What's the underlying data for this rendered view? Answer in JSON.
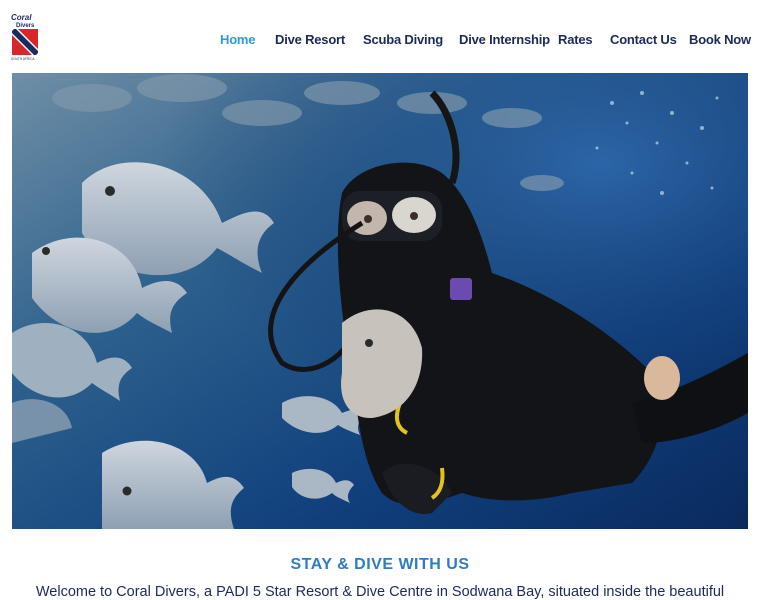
{
  "brand": {
    "logo_line1": "Coral",
    "logo_line2": "Divers",
    "logo_sub": "SOUTH AFRICA",
    "colors": {
      "navy": "#1b2a5c",
      "accent": "#2e9bd6",
      "flag_red": "#d9262b"
    }
  },
  "nav": {
    "items": [
      {
        "label": "Home",
        "active": true
      },
      {
        "label": "Dive Resort",
        "active": false
      },
      {
        "label": "Scuba Diving",
        "active": false
      },
      {
        "label": "Dive Internship",
        "active": false
      },
      {
        "label": "Rates",
        "active": false
      },
      {
        "label": "Contact Us",
        "active": false
      },
      {
        "label": "Book Now",
        "active": false
      }
    ]
  },
  "hero": {
    "image": "scuba-diver-with-fish-school-photo"
  },
  "section": {
    "heading": "STAY & DIVE WITH US",
    "intro": "Welcome to Coral Divers, a  PADI 5 Star Resort & Dive Centre in Sodwana Bay, situated inside the beautiful"
  }
}
